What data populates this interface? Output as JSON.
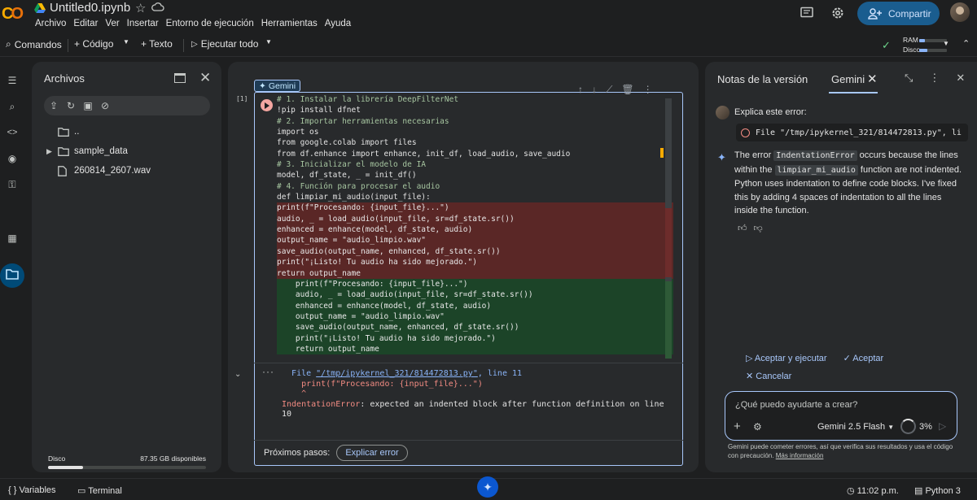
{
  "app": {
    "logo": "CO",
    "title": "Untitled0.ipynb",
    "menu": [
      "Archivo",
      "Editar",
      "Ver",
      "Insertar",
      "Entorno de ejecución",
      "Herramientas",
      "Ayuda"
    ],
    "share_label": "Compartir"
  },
  "toolbar": {
    "commands": "Comandos",
    "code": "+ Código",
    "text": "+ Texto",
    "run_all": "Ejecutar todo",
    "ram_label": "RAM",
    "disk_label": "Disco",
    "ram_fraction": 0.2,
    "disk_fraction": 0.3
  },
  "files": {
    "title": "Archivos",
    "items": [
      {
        "name": "..",
        "type": "folder",
        "expandable": false
      },
      {
        "name": "sample_data",
        "type": "folder",
        "expandable": true
      },
      {
        "name": "260814_2607.wav",
        "type": "file",
        "expandable": false
      }
    ],
    "disk_label": "Disco",
    "disk_free": "87.35 GB disponibles",
    "disk_used_fraction": 0.22
  },
  "notebook": {
    "cell_number": "[1]",
    "gemini_chip": "Gemini",
    "code_lines": [
      {
        "t": "# 1. Instalar la librería DeepFilterNet",
        "k": "cm"
      },
      {
        "t": "!pip install dfnet",
        "k": ""
      },
      {
        "t": "# 2. Importar herramientas necesarias",
        "k": "cm"
      },
      {
        "t": "import os",
        "k": ""
      },
      {
        "t": "from google.colab import files",
        "k": ""
      },
      {
        "t": "from df.enhance import enhance, init_df, load_audio, save_audio",
        "k": ""
      },
      {
        "t": "# 3. Inicializar el modelo de IA",
        "k": "cm"
      },
      {
        "t": "model, df_state, _ = init_df()",
        "k": ""
      },
      {
        "t": "# 4. Función para procesar el audio",
        "k": "cm"
      },
      {
        "t": "def limpiar_mi_audio(input_file):",
        "k": ""
      },
      {
        "t": "print(f\"Procesando: {input_file}...\")",
        "k": "del"
      },
      {
        "t": "audio, _ = load_audio(input_file, sr=df_state.sr())",
        "k": "del"
      },
      {
        "t": "enhanced = enhance(model, df_state, audio)",
        "k": "del"
      },
      {
        "t": "output_name = \"audio_limpio.wav\"",
        "k": "del"
      },
      {
        "t": "save_audio(output_name, enhanced, df_state.sr())",
        "k": "del"
      },
      {
        "t": "print(\"¡Listo! Tu audio ha sido mejorado.\")",
        "k": "del"
      },
      {
        "t": "return output_name",
        "k": "del"
      },
      {
        "t": "    print(f\"Procesando: {input_file}...\")",
        "k": "add"
      },
      {
        "t": "    audio, _ = load_audio(input_file, sr=df_state.sr())",
        "k": "add"
      },
      {
        "t": "    enhanced = enhance(model, df_state, audio)",
        "k": "add"
      },
      {
        "t": "    output_name = \"audio_limpio.wav\"",
        "k": "add"
      },
      {
        "t": "    save_audio(output_name, enhanced, df_state.sr())",
        "k": "add"
      },
      {
        "t": "    print(\"¡Listo! Tu audio ha sido mejorado.\")",
        "k": "add"
      },
      {
        "t": "    return output_name",
        "k": "add"
      }
    ],
    "output": {
      "file_prefix": "File ",
      "file_path": "\"/tmp/ipykernel_321/814472813.py\"",
      "file_suffix": ", line 11",
      "src_line": "print(f\"Procesando: {input_file}...\")",
      "caret": "^",
      "error_name": "IndentationError",
      "error_msg": ": expected an indented block after function definition on line",
      "error_line": "10"
    },
    "next_steps_label": "Próximos pasos:",
    "explain_error_label": "Explicar error"
  },
  "panel": {
    "tab_notes": "Notas de la versión",
    "tab_gemini": "Gemini",
    "user_question": "Explica este error:",
    "code_chip": "File \"/tmp/ipykernel_321/814472813.py\", li",
    "answer_part1": "The error ",
    "answer_code1": "IndentationError",
    "answer_part2": " occurs because the lines within the ",
    "answer_code2": "limpiar_mi_audio",
    "answer_part3": " function are not indented. Python uses indentation to define code blocks. I've fixed this by adding 4 spaces of indentation to all the lines inside the function.",
    "accept_run": "Aceptar y ejecutar",
    "accept": "Aceptar",
    "cancel": "Cancelar",
    "prompt_placeholder": "¿Qué puedo ayudarte a crear?",
    "model": "Gemini 2.5 Flash",
    "usage": "3%",
    "usage_fraction": 0.03,
    "disclaimer": "Gemini puede cometer errores, así que verifica sus resultados y usa el código con precaución.",
    "disclaimer_link": "Más información"
  },
  "status": {
    "variables": "Variables",
    "terminal": "Terminal",
    "time": "11:02 p.m.",
    "runtime": "Python 3"
  }
}
